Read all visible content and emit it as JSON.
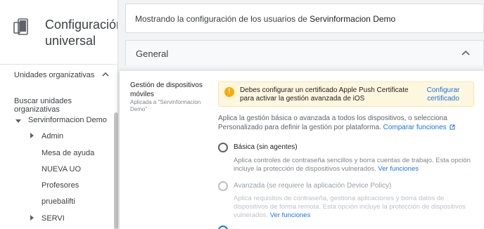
{
  "sidebar": {
    "title": "Configuración universal",
    "ou_header": "Unidades organizativas",
    "search_ou": "Buscar unidades organizativas",
    "tree": [
      {
        "label": "Servinformacion Demo",
        "expander": "down"
      },
      {
        "label": "Admin",
        "expander": "right"
      },
      {
        "label": "Mesa de ayuda",
        "expander": "none"
      },
      {
        "label": "NUEVA UO",
        "expander": "none"
      },
      {
        "label": "Profesores",
        "expander": "none"
      },
      {
        "label": "pruebalifti",
        "expander": "none"
      },
      {
        "label": "SERVI",
        "expander": "right"
      }
    ]
  },
  "top": {
    "prefix": "Mostrando la configuración de los usuarios de",
    "org": "Servinformacion Demo"
  },
  "section": {
    "title": "General"
  },
  "setting": {
    "name": "Gestión de dispositivos móviles",
    "applied": "Aplicada a \"Servinformacion Demo\"",
    "alert_text": "Debes configurar un certificado Apple Push Certificate para activar la gestión avanzada de iOS",
    "alert_link": "Configurar certificado",
    "description": "Aplica la gestión básica o avanzada a todos los dispositivos, o selecciona Personalizado para definir la gestión por plataforma.",
    "compare_link": "Comparar funciones",
    "options": [
      {
        "title": "Básica (sin agentes)",
        "desc": "Aplica controles de contraseña sencillos y borra cuentas de trabajo. Esta opción incluye la protección de dispositivos vulnerados.",
        "link": "Ver funciones",
        "disabled": false
      },
      {
        "title": "Avanzada (se requiere la aplicación Device Policy)",
        "desc": "Aplica requisitos de contraseña, gestiona aplicaciones y borra datos de dispositivos de forma remota. Esta opción incluye la protección de dispositivos vulnerados.",
        "link": "Ver funciones",
        "disabled": true
      }
    ]
  },
  "colors": {
    "accent": "#1a73e8",
    "warning": "#f9ab00",
    "alert_bg": "#fef7e0"
  }
}
